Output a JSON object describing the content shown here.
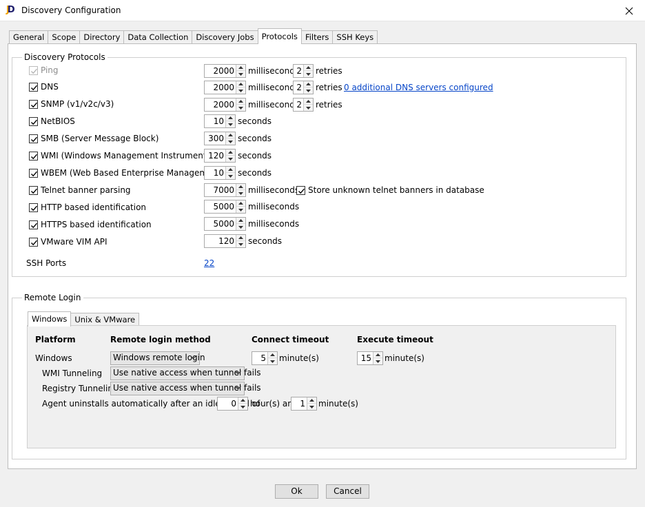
{
  "window": {
    "title": "Discovery Configuration",
    "app_icon_j": "J",
    "app_icon_d": "D"
  },
  "tabs": [
    {
      "label": "General"
    },
    {
      "label": "Scope"
    },
    {
      "label": "Directory"
    },
    {
      "label": "Data Collection"
    },
    {
      "label": "Discovery Jobs"
    },
    {
      "label": "Protocols",
      "active": true
    },
    {
      "label": "Filters"
    },
    {
      "label": "SSH Keys"
    }
  ],
  "protocols": {
    "group_label": "Discovery Protocols",
    "ping": {
      "label": "Ping",
      "checked": true,
      "disabled": true,
      "timeout": "2000",
      "timeout_unit": "milliseconds",
      "retries": "2",
      "retries_unit": "retries"
    },
    "dns": {
      "label": "DNS",
      "checked": true,
      "timeout": "2000",
      "timeout_unit": "milliseconds",
      "retries": "2",
      "retries_unit": "retries",
      "link": "0 additional DNS servers configured"
    },
    "snmp": {
      "label": "SNMP (v1/v2c/v3)",
      "checked": true,
      "timeout": "2000",
      "timeout_unit": "milliseconds",
      "retries": "2",
      "retries_unit": "retries"
    },
    "netbios": {
      "label": "NetBIOS",
      "checked": true,
      "timeout": "10",
      "timeout_unit": "seconds"
    },
    "smb": {
      "label": "SMB (Server Message Block)",
      "checked": true,
      "timeout": "300",
      "timeout_unit": "seconds"
    },
    "wmi": {
      "label": "WMI (Windows Management Instrumentation)",
      "checked": true,
      "timeout": "120",
      "timeout_unit": "seconds"
    },
    "wbem": {
      "label": "WBEM (Web Based Enterprise Management)",
      "checked": true,
      "timeout": "10",
      "timeout_unit": "seconds"
    },
    "telnet": {
      "label": "Telnet banner parsing",
      "checked": true,
      "timeout": "7000",
      "timeout_unit": "milliseconds",
      "store_label": "Store unknown telnet banners in database",
      "store_checked": true
    },
    "http": {
      "label": "HTTP based identification",
      "checked": true,
      "timeout": "5000",
      "timeout_unit": "milliseconds"
    },
    "https": {
      "label": "HTTPS based identification",
      "checked": true,
      "timeout": "5000",
      "timeout_unit": "milliseconds"
    },
    "vmware": {
      "label": "VMware VIM API",
      "checked": true,
      "timeout": "120",
      "timeout_unit": "seconds"
    },
    "ssh_ports_label": "SSH Ports",
    "ssh_ports_value": "22"
  },
  "remote_login": {
    "group_label": "Remote Login",
    "tabs": [
      {
        "label": "Windows",
        "active": true
      },
      {
        "label": "Unix & VMware"
      }
    ],
    "headers": {
      "platform": "Platform",
      "method": "Remote login method",
      "connect": "Connect timeout",
      "execute": "Execute timeout"
    },
    "windows_label": "Windows",
    "windows_method": "Windows remote login",
    "connect_timeout": "5",
    "connect_unit": "minute(s)",
    "execute_timeout": "15",
    "execute_unit": "minute(s)",
    "wmi_tunneling_label": "WMI Tunneling",
    "wmi_tunneling_value": "Use native access when tunnel fails",
    "registry_tunneling_label": "Registry Tunneling",
    "registry_tunneling_value": "Use native access when tunnel fails",
    "agent_label": "Agent uninstalls automatically after an idle period of",
    "agent_hours": "0",
    "agent_hours_unit": "hour(s) and",
    "agent_minutes": "1",
    "agent_minutes_unit": "minute(s)"
  },
  "buttons": {
    "ok": "Ok",
    "cancel": "Cancel"
  }
}
